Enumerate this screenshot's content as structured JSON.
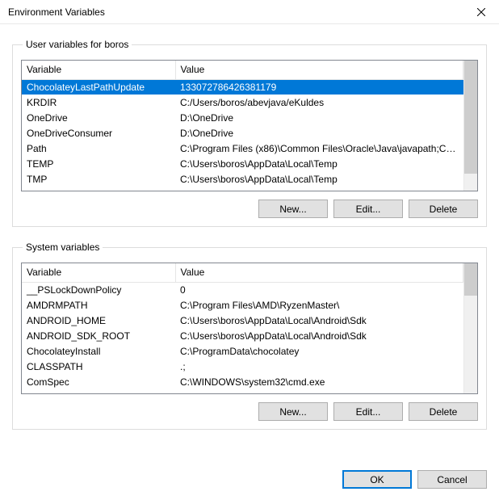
{
  "window": {
    "title": "Environment Variables"
  },
  "user_section": {
    "legend": "User variables for boros",
    "col_variable": "Variable",
    "col_value": "Value",
    "rows": [
      {
        "variable": "ChocolateyLastPathUpdate",
        "value": "133072786426381179",
        "selected": true
      },
      {
        "variable": "KRDIR",
        "value": "C:/Users/boros/abevjava/eKuldes"
      },
      {
        "variable": "OneDrive",
        "value": "D:\\OneDrive"
      },
      {
        "variable": "OneDriveConsumer",
        "value": "D:\\OneDrive"
      },
      {
        "variable": "Path",
        "value": "C:\\Program Files (x86)\\Common Files\\Oracle\\Java\\javapath;C:\\Pro..."
      },
      {
        "variable": "TEMP",
        "value": "C:\\Users\\boros\\AppData\\Local\\Temp"
      },
      {
        "variable": "TMP",
        "value": "C:\\Users\\boros\\AppData\\Local\\Temp"
      }
    ],
    "btn_new": "New...",
    "btn_edit": "Edit...",
    "btn_delete": "Delete"
  },
  "system_section": {
    "legend": "System variables",
    "col_variable": "Variable",
    "col_value": "Value",
    "rows": [
      {
        "variable": "__PSLockDownPolicy",
        "value": "0"
      },
      {
        "variable": "AMDRMPATH",
        "value": "C:\\Program Files\\AMD\\RyzenMaster\\"
      },
      {
        "variable": "ANDROID_HOME",
        "value": "C:\\Users\\boros\\AppData\\Local\\Android\\Sdk"
      },
      {
        "variable": "ANDROID_SDK_ROOT",
        "value": "C:\\Users\\boros\\AppData\\Local\\Android\\Sdk"
      },
      {
        "variable": "ChocolateyInstall",
        "value": "C:\\ProgramData\\chocolatey"
      },
      {
        "variable": "CLASSPATH",
        "value": ".;"
      },
      {
        "variable": "ComSpec",
        "value": "C:\\WINDOWS\\system32\\cmd.exe"
      }
    ],
    "btn_new": "New...",
    "btn_edit": "Edit...",
    "btn_delete": "Delete"
  },
  "footer": {
    "ok": "OK",
    "cancel": "Cancel"
  }
}
